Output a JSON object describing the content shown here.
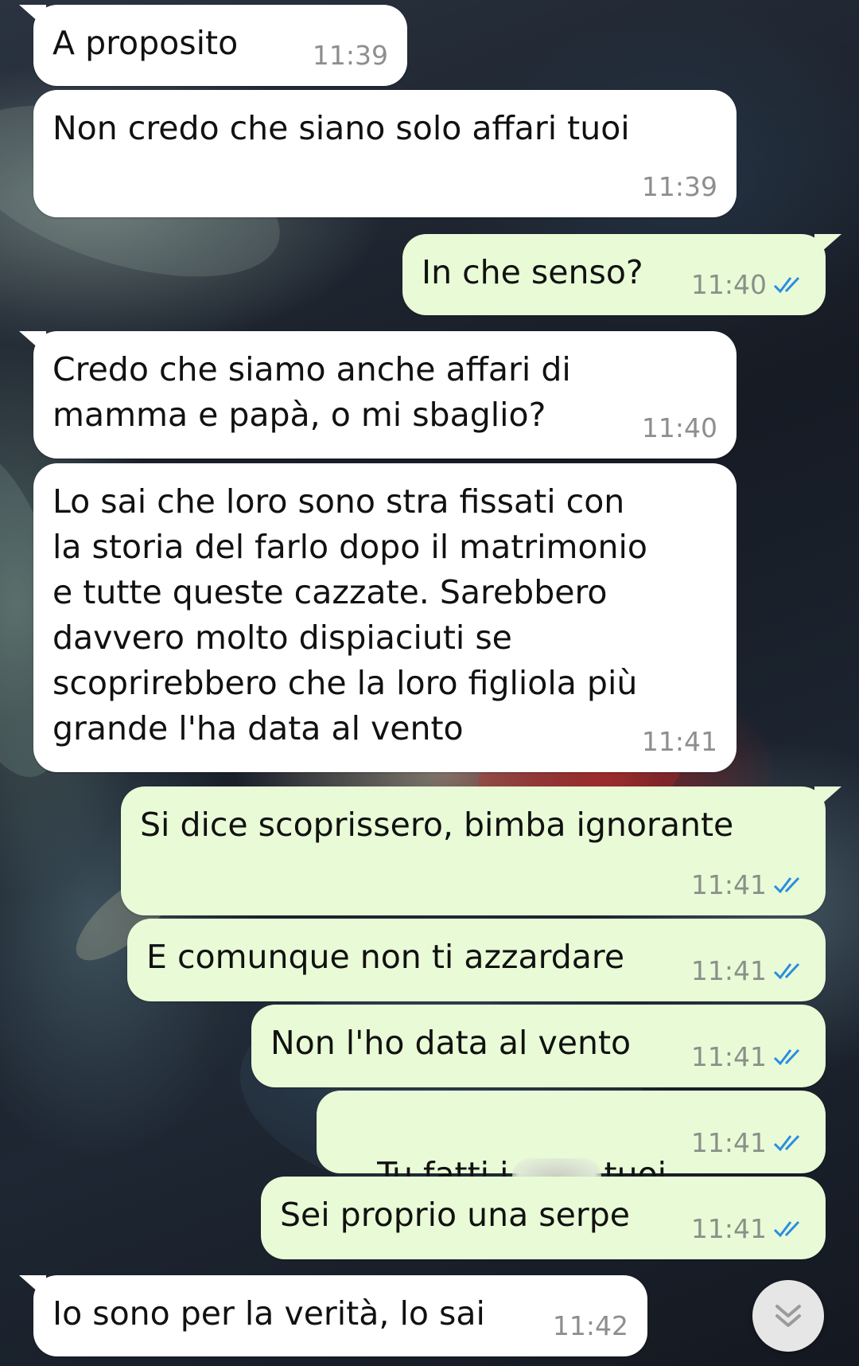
{
  "chat": {
    "messages": [
      {
        "direction": "in",
        "text": "A proposito",
        "time": "11:39"
      },
      {
        "direction": "in",
        "text": "Non credo che siano solo affari tuoi",
        "time": "11:39"
      },
      {
        "direction": "out",
        "text": "In che senso?",
        "time": "11:40",
        "status": "read"
      },
      {
        "direction": "in",
        "text": "Credo che siamo anche affari di\nmamma e papà, o mi sbaglio?",
        "time": "11:40"
      },
      {
        "direction": "in",
        "text": "Lo sai che loro sono stra fissati con\nla storia del farlo dopo il matrimonio\ne tutte queste cazzate. Sarebbero\ndavvero molto dispiaciuti se\nscoprirebbero che la loro figliola più\ngrande l'ha data al vento",
        "time": "11:41"
      },
      {
        "direction": "out",
        "text": "Si dice scoprissero, bimba ignorante",
        "time": "11:41",
        "status": "read"
      },
      {
        "direction": "out",
        "text": "E comunque non ti azzardare",
        "time": "11:41",
        "status": "read"
      },
      {
        "direction": "out",
        "text": "Non l'ho data al vento",
        "time": "11:41",
        "status": "read"
      },
      {
        "direction": "out",
        "text_before": "Tu fatti i",
        "text_after": "tuoi",
        "time": "11:41",
        "status": "read",
        "redacted": true
      },
      {
        "direction": "out",
        "text": "Sei proprio una serpe",
        "time": "11:41",
        "status": "read"
      },
      {
        "direction": "in",
        "text": "Io sono per la verità, lo sai",
        "time": "11:42"
      }
    ]
  },
  "colors": {
    "incoming_bubble": "#ffffff",
    "outgoing_bubble": "#e8fbd6",
    "read_ticks": "#2a8de0"
  },
  "icons": {
    "read_status": "double-check-icon",
    "scroll_down": "chevron-double-down-icon"
  }
}
